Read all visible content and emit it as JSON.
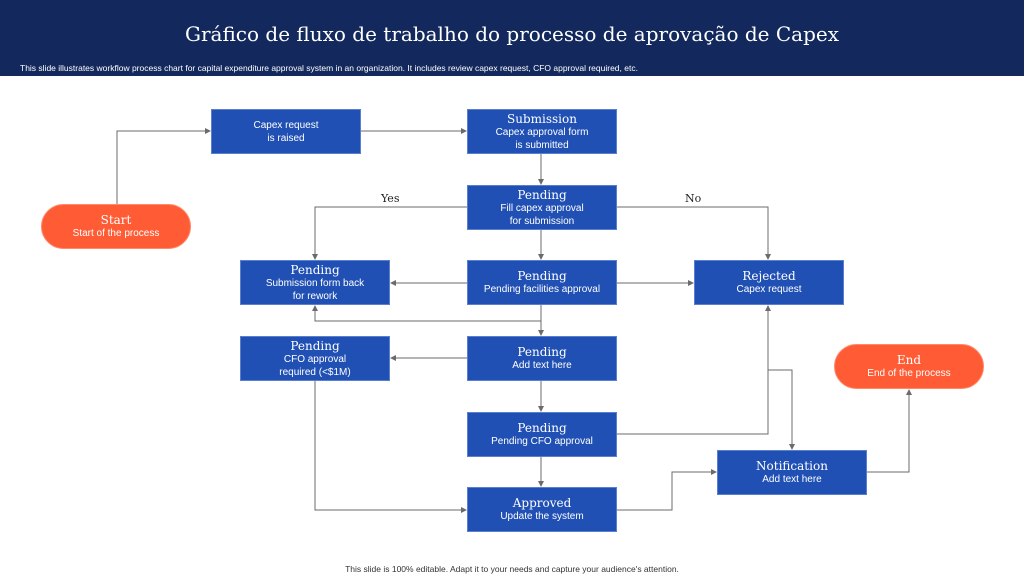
{
  "header": {
    "title": "Gráfico de fluxo de trabalho do processo de aprovação de Capex",
    "subtitle": "This slide illustrates workflow process chart for capital expenditure approval system in an organization. It includes review capex request, CFO approval required, etc."
  },
  "nodes": {
    "start": {
      "heading": "Start",
      "text": "Start of the process"
    },
    "raised": {
      "heading": "",
      "text": "Capex request\nis raised"
    },
    "submission": {
      "heading": "Submission",
      "text": "Capex approval form\nis submitted"
    },
    "fill": {
      "heading": "Pending",
      "text": "Fill capex approval\nfor submission"
    },
    "rework": {
      "heading": "Pending",
      "text": "Submission form back\nfor rework"
    },
    "facilities": {
      "heading": "Pending",
      "text": "Pending facilities approval"
    },
    "rejected": {
      "heading": "Rejected",
      "text": "Capex request"
    },
    "cfo_required": {
      "heading": "Pending",
      "text": "CFO approval\nrequired (<$1M)"
    },
    "add_text": {
      "heading": "Pending",
      "text": "Add text here"
    },
    "cfo_pending": {
      "heading": "Pending",
      "text": "Pending CFO approval"
    },
    "approved": {
      "heading": "Approved",
      "text": "Update the system"
    },
    "notification": {
      "heading": "Notification",
      "text": "Add text here"
    },
    "end": {
      "heading": "End",
      "text": "End of the process"
    }
  },
  "labels": {
    "yes": "Yes",
    "no": "No"
  },
  "footer": "This slide is 100% editable. Adapt it to your needs and capture your audience's attention.",
  "colors": {
    "header": "#13285c",
    "box": "#2150b4",
    "terminal": "#ff5b35",
    "line": "#6b6b6b"
  }
}
